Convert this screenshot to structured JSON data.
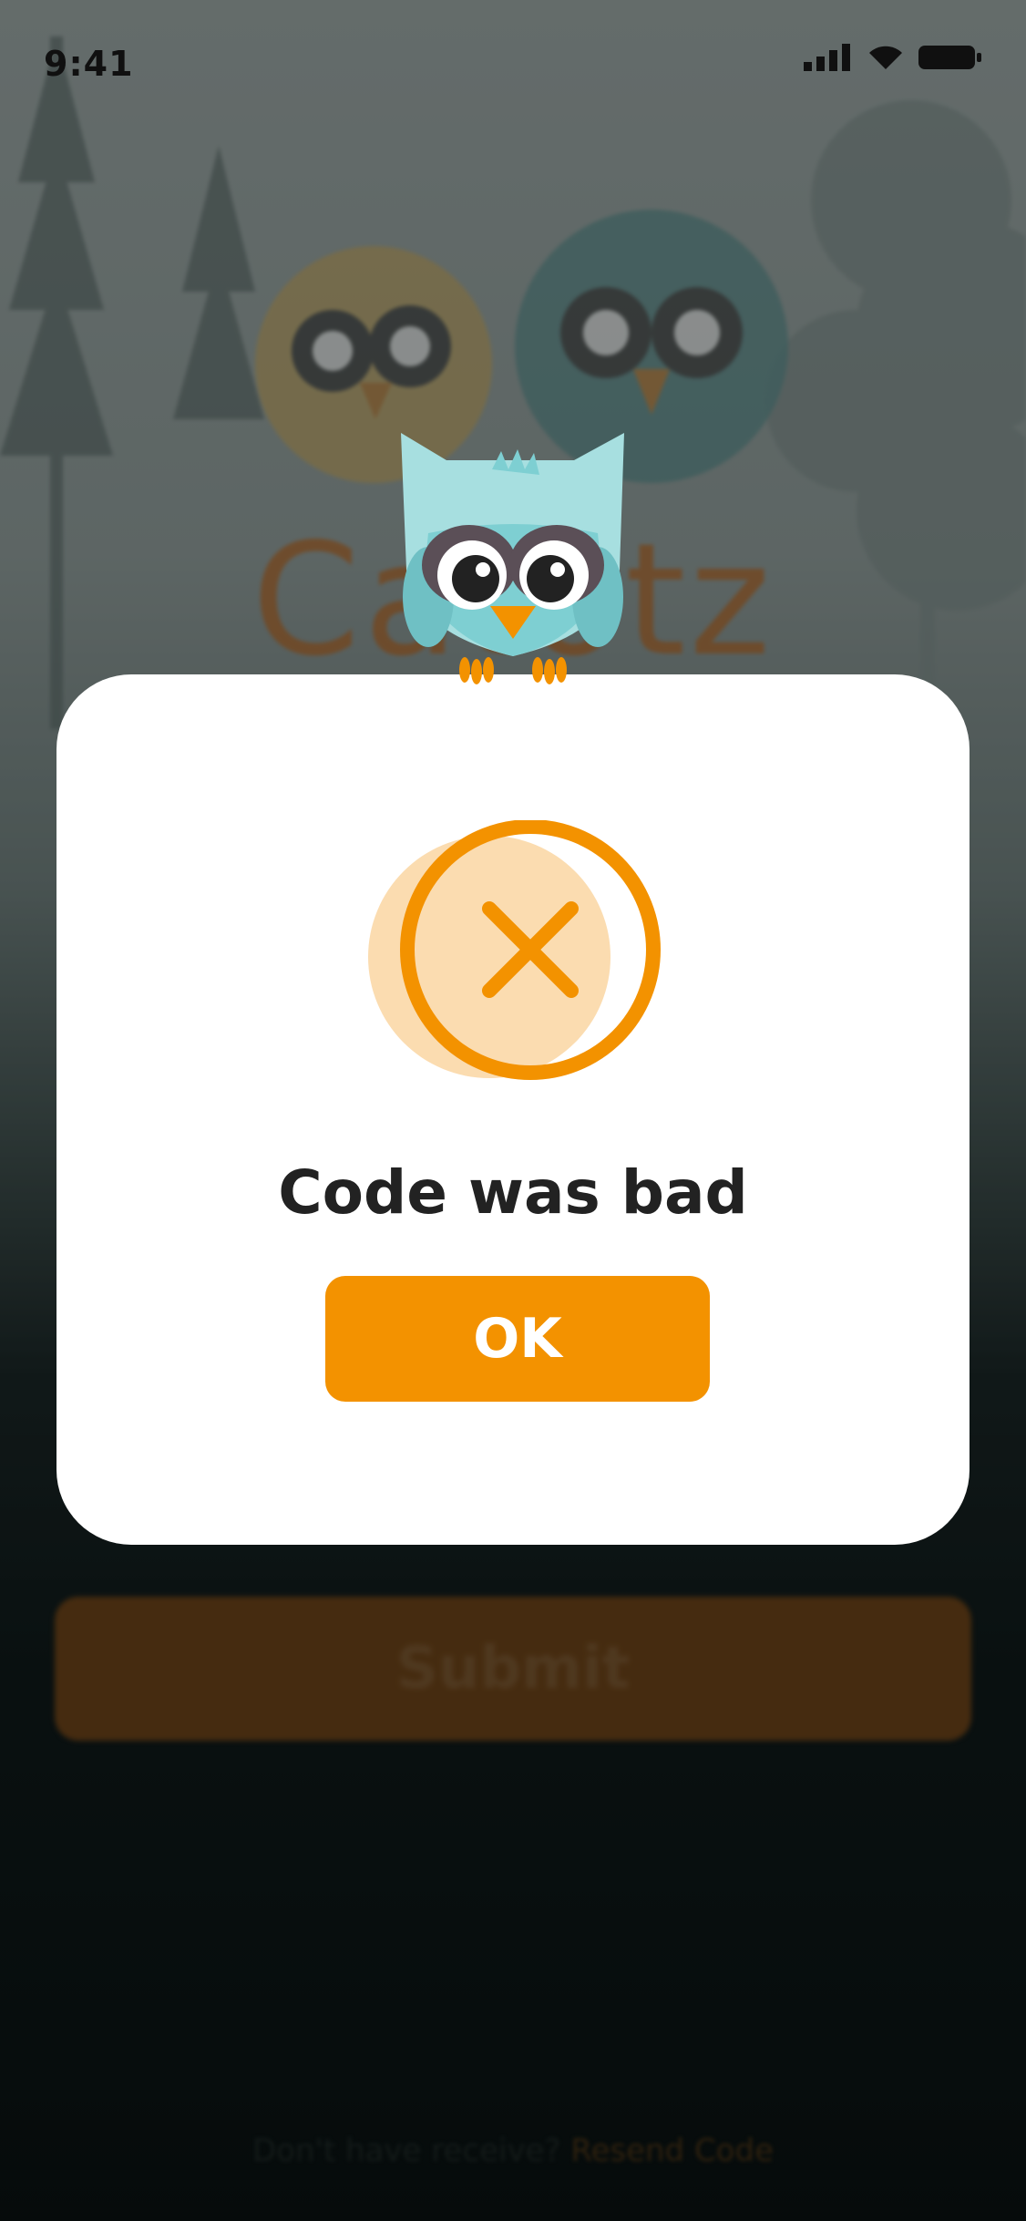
{
  "status_bar": {
    "time": "9:41"
  },
  "background": {
    "brand_name": "Catotz",
    "submit_label": "Submit",
    "resend_prompt": "Don't have receive?",
    "resend_link": "Resend Code"
  },
  "dialog": {
    "message": "Code was bad",
    "ok_label": "OK",
    "icon": "error-x-icon",
    "accent_color": "#f39200"
  }
}
